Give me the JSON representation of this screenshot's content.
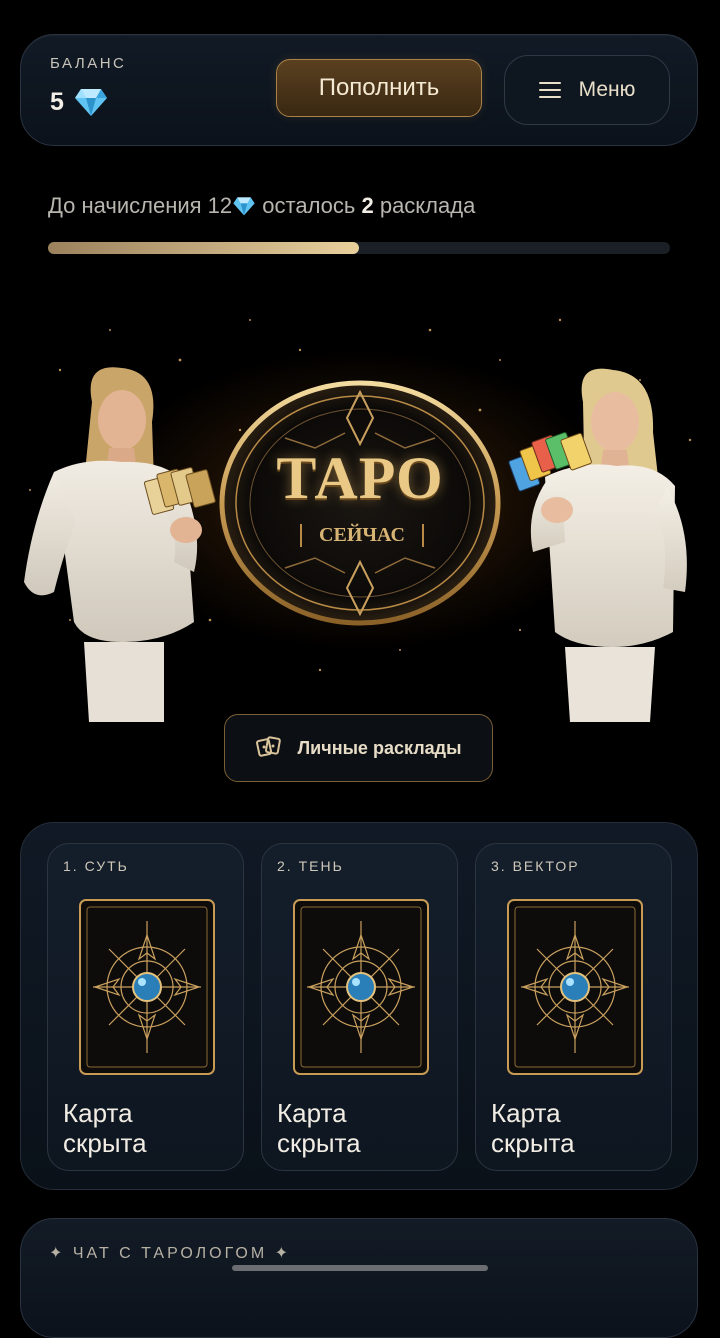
{
  "header": {
    "balance_label": "БАЛАНС",
    "balance_value": "5",
    "balance_icon": "diamond-icon",
    "topup_label": "Пополнить",
    "menu_label": "Меню",
    "menu_icon": "hamburger-icon"
  },
  "progress": {
    "text_before": "До начисления 12",
    "text_mid": " осталось ",
    "remaining": "2",
    "text_after": " расклада",
    "fill_fraction": 0.5
  },
  "hero": {
    "logo_title": "ТАРО",
    "logo_subtitle": "СЕЙЧАС"
  },
  "personal_readings": {
    "label": "Личные расклады",
    "icon": "cards-icon"
  },
  "cards": [
    {
      "label": "1. СУТЬ",
      "status": "Карта скрыта"
    },
    {
      "label": "2. ТЕНЬ",
      "status": "Карта скрыта"
    },
    {
      "label": "3. ВЕКТОР",
      "status": "Карта скрыта"
    }
  ],
  "chat": {
    "title": "ЧАТ С ТАРОЛОГОМ"
  },
  "colors": {
    "accent_gold": "#c9a56b",
    "background": "#000000",
    "panel": "#0f1822"
  }
}
